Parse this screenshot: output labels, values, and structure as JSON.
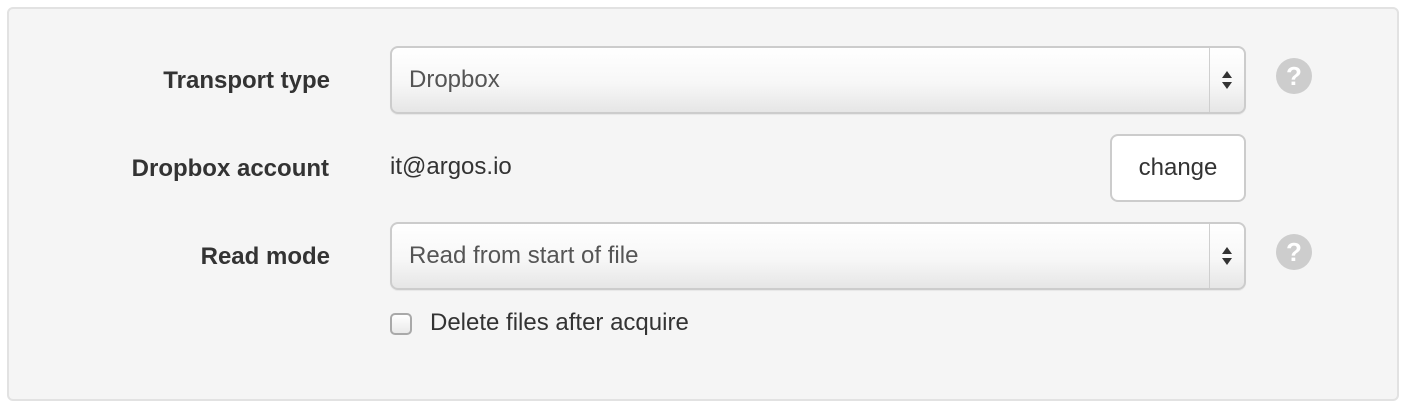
{
  "form": {
    "transport_type": {
      "label": "Transport type",
      "value": "Dropbox",
      "help_icon": "question-circle-icon",
      "help_glyph": "?"
    },
    "dropbox_account": {
      "label": "Dropbox account",
      "value": "it@argos.io",
      "change_label": "change"
    },
    "read_mode": {
      "label": "Read mode",
      "value": "Read from start of file",
      "help_icon": "question-circle-icon",
      "help_glyph": "?"
    },
    "delete_files": {
      "label": "Delete files after acquire",
      "checked": false
    }
  },
  "colors": {
    "panel_background": "#f5f5f5",
    "panel_border": "#e2e2e2",
    "label_text": "#333333",
    "select_text": "#555555",
    "help_icon": "#cdcdcd"
  }
}
